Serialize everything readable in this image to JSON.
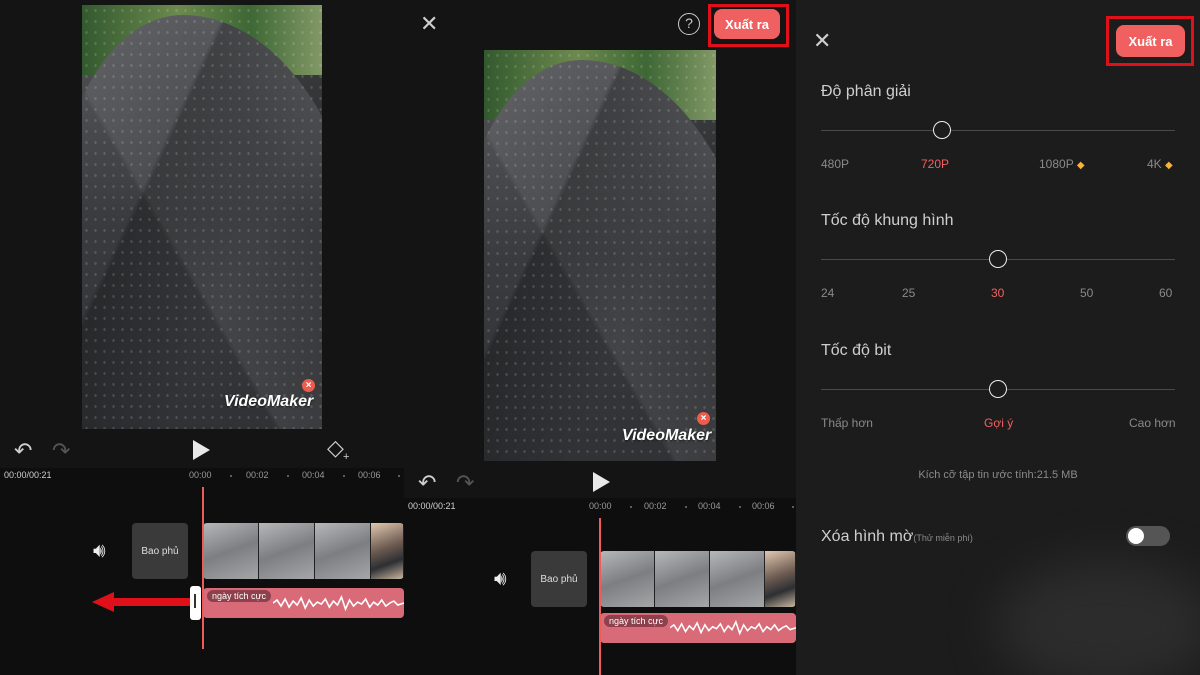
{
  "panel1": {
    "watermark": "VideoMaker",
    "watermark_close": "×",
    "undo_icon": "↶",
    "redo_icon": "↷",
    "keyframe_icon": "◇",
    "time": "00:00/00:21",
    "ruler": [
      "00:00",
      "00:02",
      "00:04",
      "00:06"
    ],
    "overlay_label": "Bao phủ",
    "audio_label": "ngày tích cực"
  },
  "panel2": {
    "close_icon": "✕",
    "help_icon": "?",
    "export_label": "Xuất ra",
    "watermark": "VideoMaker",
    "watermark_close": "×",
    "undo_icon": "↶",
    "redo_icon": "↷",
    "time": "00:00/00:21",
    "ruler": [
      "00:00",
      "00:02",
      "00:04",
      "00:06"
    ],
    "overlay_label": "Bao phủ",
    "audio_label": "ngày tích cực"
  },
  "panel3": {
    "close_icon": "✕",
    "export_label": "Xuất ra",
    "resolution": {
      "title": "Độ phân giải",
      "options": [
        "480P",
        "720P",
        "1080P",
        "4K"
      ],
      "premium": [
        false,
        false,
        true,
        true
      ],
      "selected": "720P"
    },
    "framerate": {
      "title": "Tốc độ khung hình",
      "options": [
        "24",
        "25",
        "30",
        "50",
        "60"
      ],
      "selected": "30"
    },
    "bitrate": {
      "title": "Tốc độ bit",
      "options": [
        "Thấp hơn",
        "Gợi ý",
        "Cao hơn"
      ],
      "selected": "Gợi ý"
    },
    "file_size": "Kích cỡ tập tin ước tính:21.5 MB",
    "remove_watermark": "Xóa hình mờ",
    "remove_watermark_note": "(Thử miễn phí)",
    "remove_watermark_on": false
  },
  "colors": {
    "accent": "#f06060",
    "highlight": "#e0101a",
    "audio_track": "#d96b79",
    "premium_gem": "#f5b43a"
  }
}
